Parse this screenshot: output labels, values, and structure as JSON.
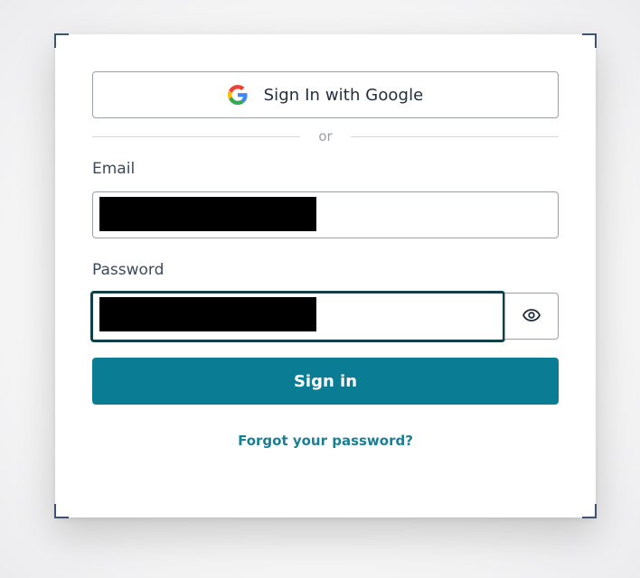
{
  "google_button": {
    "label": "Sign In with Google",
    "icon": "google-g-icon"
  },
  "divider": {
    "text": "or"
  },
  "email": {
    "label": "Email",
    "value": "[redacted]"
  },
  "password": {
    "label": "Password",
    "value": "[redacted]",
    "toggle_icon": "eye-icon"
  },
  "signin_button": {
    "label": "Sign in"
  },
  "forgot_link": {
    "label": "Forgot your password?"
  },
  "colors": {
    "accent": "#0a7d94",
    "link": "#1b7f94",
    "focus_border": "#12404a",
    "border": "#9aa0a6"
  }
}
